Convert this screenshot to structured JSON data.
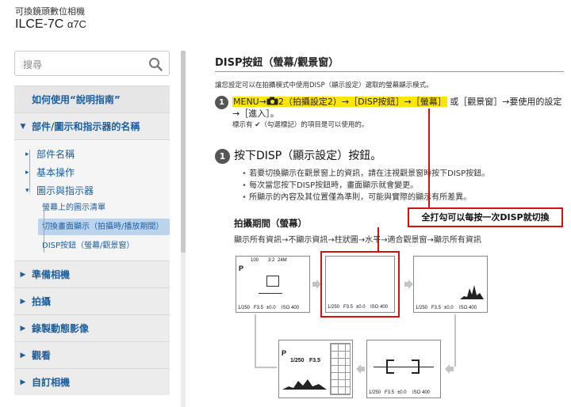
{
  "header": {
    "subtitle": "可換鏡頭數位相機",
    "model": "ILCE-7C",
    "model_suffix": "α7C"
  },
  "search": {
    "placeholder": "搜尋"
  },
  "sidebar": {
    "howto": "如何使用“說明指南”",
    "section_open": "部件/圖示和指示器的名稱",
    "sub_items": [
      "部件名稱",
      "基本操作",
      "圖示與指示器"
    ],
    "leaf_items": [
      "螢幕上的圖示清單",
      "切換畫面顯示（拍攝時/播放期間）",
      "DISP按鈕（螢幕/觀景窗）"
    ],
    "sections": [
      "準備相機",
      "拍攝",
      "錄製動態影像",
      "觀看",
      "自訂相機"
    ]
  },
  "main": {
    "title": "DISP按鈕（螢幕/觀景窗）",
    "intro": "讓您設定可以在拍攝模式中使用DISP（顯示設定）選取的螢幕顯示模式。",
    "menu_step": {
      "num": "1",
      "hl_a": "MENU→",
      "hl_b": "2（拍攝設定2）→［DISP按鈕］→［螢幕］",
      "rest": "或［觀景窗］→要使用的設定→［進入］。",
      "note": "標示有 ✔（勾選標記）的項目是可以使用的。"
    },
    "step1": {
      "num": "1",
      "title": "按下DISP（顯示設定）按鈕。",
      "bullets": [
        "若要切換顯示在觀景窗上的資訊，請在注視觀景窗時按下DISP按鈕。",
        "每次當您按下DISP按鈕時，畫面顯示就會變更。",
        "所顯示的內容及其位置僅為準則，可能與實際的顯示有所差異。"
      ]
    },
    "callout": "全打勾可以每按一次DISP就切換",
    "shooting": {
      "title": "拍攝期間（螢幕）",
      "flow": "顯示所有資訊→不顯示資訊→柱狀圖→水平→適合觀景窗→顯示所有資訊"
    },
    "screen_readout": {
      "shutter": "1/250",
      "aperture": "F3.5",
      "ev": "±0.0",
      "iso": "ISO 400",
      "mode": "P",
      "count": "100",
      "aspect": "3:2",
      "quality": "24M"
    }
  },
  "colors": {
    "accent_red": "#d81010",
    "link_blue": "#1d5e9c",
    "highlight": "#ffe600",
    "selected_bg": "#bcd3ee"
  }
}
